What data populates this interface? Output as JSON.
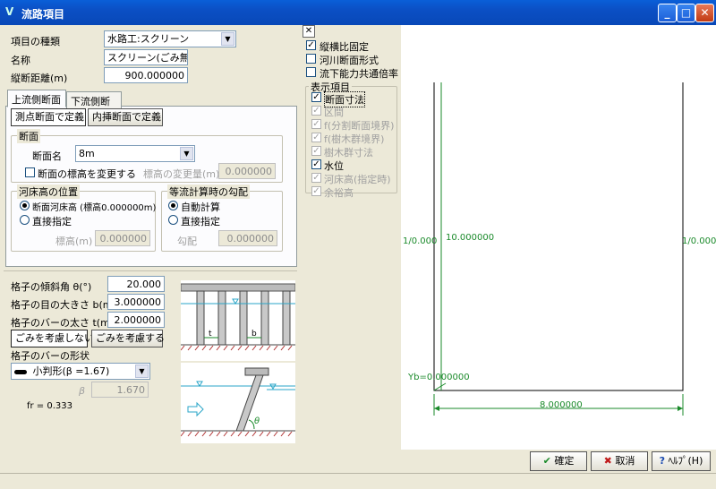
{
  "window": {
    "title": "流路項目",
    "min": "_",
    "max": "□",
    "close": "✕"
  },
  "form": {
    "type_label": "項目の種類",
    "type_value": "水路工:スクリーン",
    "name_label": "名称",
    "name_value": "スクリーン(ごみ無し",
    "distance_label": "縦断距離(m)",
    "distance_value": "900.000000"
  },
  "tabs": [
    "上流側断面",
    "下流側断面"
  ],
  "section_btns": [
    "測点断面で定義",
    "内挿断面で定義"
  ],
  "section": {
    "group_title": "断面",
    "name_label": "断面名",
    "name_value": "8m",
    "change_label": "断面の標高を変更する",
    "change_amount_label": "標高の変更量(m)",
    "change_amount_value": "0.000000"
  },
  "bed": {
    "group_title": "河床高の位置",
    "opt1": "断面河床高 (標高0.000000m)",
    "opt2": "直接指定",
    "elev_label": "標高(m)",
    "elev_value": "0.000000"
  },
  "slope": {
    "group_title": "等流計算時の勾配",
    "opt1": "自動計算",
    "opt2": "直接指定",
    "slope_label": "勾配",
    "slope_value": "0.000000"
  },
  "grid": {
    "angle_label": "格子の傾斜角 θ(°)",
    "angle_value": "20.000",
    "mesh_label": "格子の目の大きさ b(m)",
    "mesh_value": "3.000000",
    "bar_label": "格子のバーの太さ t(m)",
    "bar_value": "2.000000",
    "btn_no_debris": "ごみを考慮しない",
    "btn_debris": "ごみを考慮する",
    "shape_label": "格子のバーの形状",
    "shape_value": "小判形(β =1.67)",
    "beta_label": "β",
    "beta_value": "1.670",
    "fr": "fr = 0.333",
    "diag_t": "t",
    "diag_b": "b",
    "diag_theta": "θ"
  },
  "options": {
    "close_x": "✕",
    "fix_ratio": "縦横比固定",
    "river_form": "河川断面形式",
    "flow_factor": "流下能力共通倍率"
  },
  "display": {
    "title": "表示項目",
    "items": [
      {
        "label": "断面寸法",
        "checked": true,
        "enabled": true
      },
      {
        "label": "区間",
        "checked": true,
        "enabled": false
      },
      {
        "label": "f(分割断面境界)",
        "checked": true,
        "enabled": false
      },
      {
        "label": "f(樹木群境界)",
        "checked": true,
        "enabled": false
      },
      {
        "label": "樹木群寸法",
        "checked": true,
        "enabled": false
      },
      {
        "label": "水位",
        "checked": true,
        "enabled": true
      },
      {
        "label": "河床高(指定時)",
        "checked": true,
        "enabled": false
      },
      {
        "label": "余裕高",
        "checked": true,
        "enabled": false
      }
    ]
  },
  "drawing": {
    "left_slope": "1/0.000",
    "right_slope": "1/0.000",
    "height": "10.000000",
    "yb": "Yb=0.000000",
    "width": "8.000000"
  },
  "footer": {
    "ok": "確定",
    "cancel": "取消",
    "help": "ﾍﾙﾌﾟ(H)"
  },
  "colors": {
    "dim_green": "#1a8a2a",
    "accent": "#0a5fd8"
  }
}
